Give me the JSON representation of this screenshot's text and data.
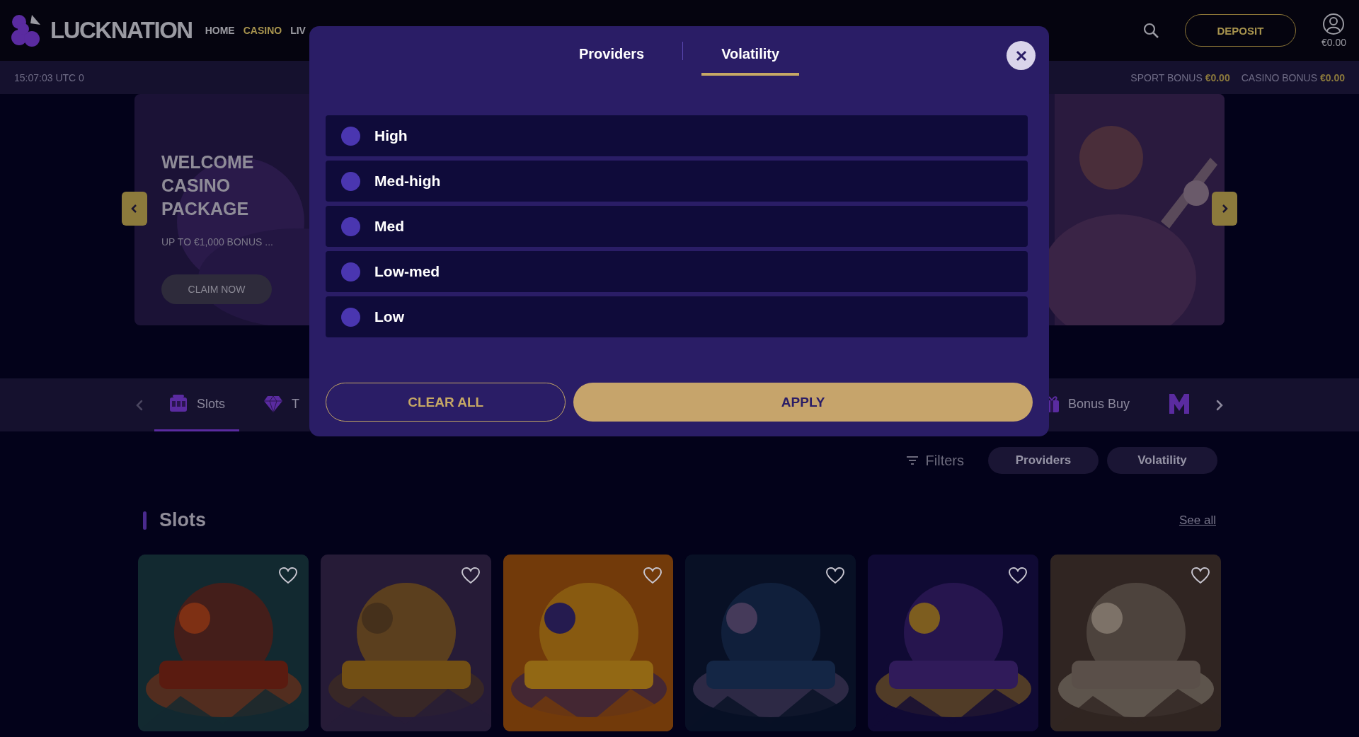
{
  "header": {
    "logo": "LUCKNATION",
    "nav": [
      {
        "label": "HOME",
        "selected": false
      },
      {
        "label": "CASINO",
        "selected": true
      },
      {
        "label": "LIV",
        "selected": false
      }
    ],
    "deposit": "DEPOSIT",
    "balance": "€0.00"
  },
  "info_bar": {
    "time": "15:07:03 UTC 0",
    "bonuses": [
      {
        "label": "SPORT BONUS",
        "amount": "€0.00"
      },
      {
        "label": "CASINO BONUS",
        "amount": "€0.00"
      }
    ]
  },
  "hero": {
    "title": "WELCOME CASINO PACKAGE",
    "subtitle": "UP TO €1,000 BONUS ...",
    "button": "CLAIM NOW"
  },
  "categories": [
    {
      "kind": "slot",
      "label": "Slots",
      "selected": true
    },
    {
      "kind": "diamond",
      "label": "T",
      "selected": false
    },
    {
      "kind": "gift",
      "label": "Bonus Buy",
      "selected": false
    },
    {
      "kind": "brand",
      "selected": false
    }
  ],
  "filters": {
    "label": "Filters",
    "buttons": [
      "Providers",
      "Volatility"
    ]
  },
  "section": {
    "title": "Slots",
    "link": "See all"
  },
  "modal": {
    "tabs": [
      {
        "label": "Providers",
        "selected": false
      },
      {
        "label": "Volatility",
        "selected": true
      }
    ],
    "options": [
      {
        "label": "High",
        "selected": false
      },
      {
        "label": "Med-high",
        "selected": false
      },
      {
        "label": "Med",
        "selected": false
      },
      {
        "label": "Low-med",
        "selected": false
      },
      {
        "label": "Low",
        "selected": false
      }
    ],
    "clear_button": "CLEAR ALL",
    "apply_button": "APPLY"
  }
}
